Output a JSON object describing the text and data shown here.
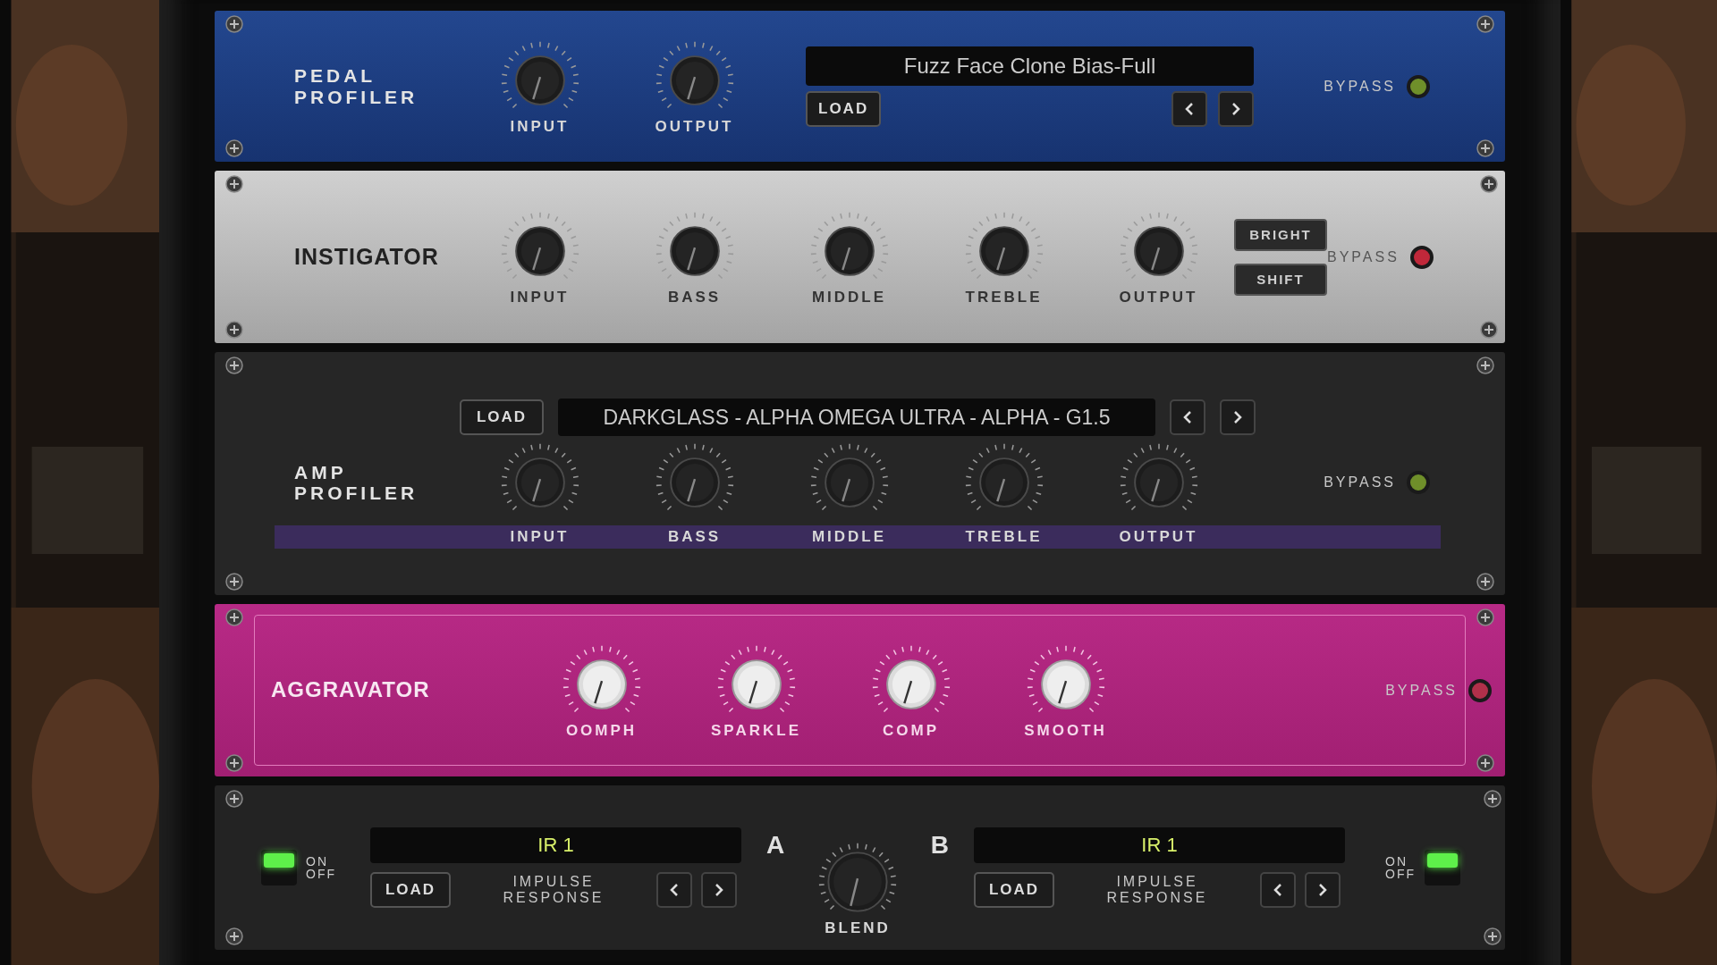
{
  "modules": [
    {
      "kind": "pedal",
      "title": "PEDAL PROFILER",
      "knobs": [
        {
          "label": "INPUT"
        },
        {
          "label": "OUTPUT"
        }
      ],
      "preset": "Fuzz Face Clone Bias-Full",
      "load": "LOAD",
      "bypass": {
        "label": "BYPASS",
        "color": "#6f8f2a"
      }
    },
    {
      "kind": "instigator",
      "title": "INSTIGATOR",
      "knobs": [
        {
          "label": "INPUT"
        },
        {
          "label": "BASS"
        },
        {
          "label": "MIDDLE"
        },
        {
          "label": "TREBLE"
        },
        {
          "label": "OUTPUT"
        }
      ],
      "buttons": [
        "BRIGHT",
        "SHIFT"
      ],
      "bypass": {
        "label": "BYPASS",
        "color": "#c0283a"
      }
    },
    {
      "kind": "amp",
      "title": "AMP PROFILER",
      "load": "LOAD",
      "preset": "DARKGLASS - ALPHA OMEGA ULTRA - ALPHA - G1.5",
      "knobs": [
        {
          "label": "INPUT"
        },
        {
          "label": "BASS"
        },
        {
          "label": "MIDDLE"
        },
        {
          "label": "TREBLE"
        },
        {
          "label": "OUTPUT"
        }
      ],
      "bypass": {
        "label": "BYPASS",
        "color": "#6f8f2a"
      }
    },
    {
      "kind": "aggravator",
      "title": "AGGRAVATOR",
      "knobs": [
        {
          "label": "OOMPH"
        },
        {
          "label": "SPARKLE"
        },
        {
          "label": "COMP"
        },
        {
          "label": "SMOOTH"
        }
      ],
      "bypass": {
        "label": "BYPASS",
        "color": "#b0304a"
      }
    },
    {
      "kind": "cab",
      "slots": [
        {
          "letter": "A",
          "on_label": "ON",
          "off_label": "OFF",
          "on": true,
          "display": "IR 1",
          "load": "LOAD",
          "caption": "IMPULSE RESPONSE"
        },
        {
          "letter": "B",
          "on_label": "ON",
          "off_label": "OFF",
          "on": true,
          "display": "IR 1",
          "load": "LOAD",
          "caption": "IMPULSE RESPONSE"
        }
      ],
      "blend": "BLEND"
    }
  ]
}
